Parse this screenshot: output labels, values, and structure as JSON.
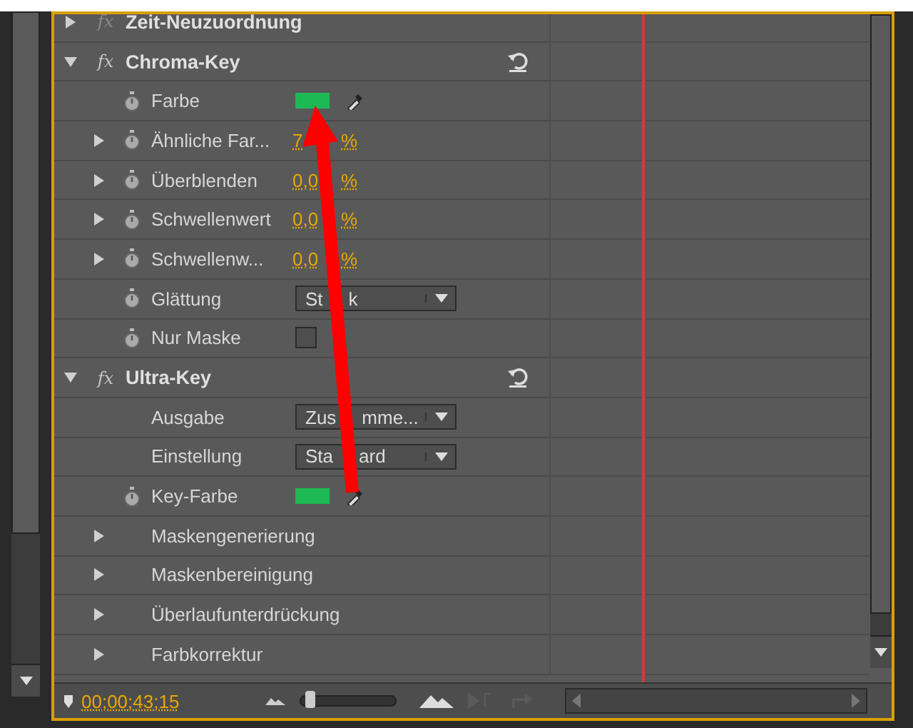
{
  "effects": [
    {
      "name": "Zeit-Neuzuordnung",
      "fx": "fx",
      "expanded": false,
      "fx_enabled": false,
      "reset": false
    },
    {
      "name": "Chroma-Key",
      "fx": "fx",
      "expanded": true,
      "fx_enabled": true,
      "reset": true,
      "params": [
        {
          "label": "Farbe",
          "kind": "color",
          "stopwatch": true,
          "expandable": false,
          "color": "#1db954"
        },
        {
          "label": "Ähnliche Far...",
          "kind": "value",
          "stopwatch": true,
          "expandable": true,
          "value_parts": [
            "7",
            "%"
          ]
        },
        {
          "label": "Überblenden",
          "kind": "value",
          "stopwatch": true,
          "expandable": true,
          "value_parts": [
            "0,0",
            "%"
          ]
        },
        {
          "label": "Schwellenwert",
          "kind": "value",
          "stopwatch": true,
          "expandable": true,
          "value_parts": [
            "0,0",
            "%"
          ]
        },
        {
          "label": "Schwellenw...",
          "kind": "value",
          "stopwatch": true,
          "expandable": true,
          "value_parts": [
            "0,0",
            "%"
          ]
        },
        {
          "label": "Glättung",
          "kind": "dropdown",
          "stopwatch": true,
          "expandable": false,
          "value_parts": [
            "St",
            "k"
          ]
        },
        {
          "label": "Nur Maske",
          "kind": "checkbox",
          "stopwatch": true,
          "expandable": false,
          "checked": false
        }
      ]
    },
    {
      "name": "Ultra-Key",
      "fx": "fx",
      "expanded": true,
      "fx_enabled": true,
      "reset": true,
      "params": [
        {
          "label": "Ausgabe",
          "kind": "dropdown",
          "stopwatch": false,
          "expandable": false,
          "value_parts": [
            "Zus",
            "mme..."
          ]
        },
        {
          "label": "Einstellung",
          "kind": "dropdown",
          "stopwatch": false,
          "expandable": false,
          "value_parts": [
            "Sta",
            "ard"
          ]
        },
        {
          "label": "Key-Farbe",
          "kind": "color",
          "stopwatch": true,
          "expandable": false,
          "color": "#1db954"
        },
        {
          "label": "Maskengenerierung",
          "kind": "group",
          "stopwatch": false,
          "expandable": true
        },
        {
          "label": "Maskenbereinigung",
          "kind": "group",
          "stopwatch": false,
          "expandable": true
        },
        {
          "label": "Überlaufunterdrückung",
          "kind": "group",
          "stopwatch": false,
          "expandable": true
        },
        {
          "label": "Farbkorrektur",
          "kind": "group",
          "stopwatch": false,
          "expandable": true
        }
      ]
    }
  ],
  "footer": {
    "timecode": "00;00;43;15",
    "zoom": {
      "level": 0.05
    }
  }
}
